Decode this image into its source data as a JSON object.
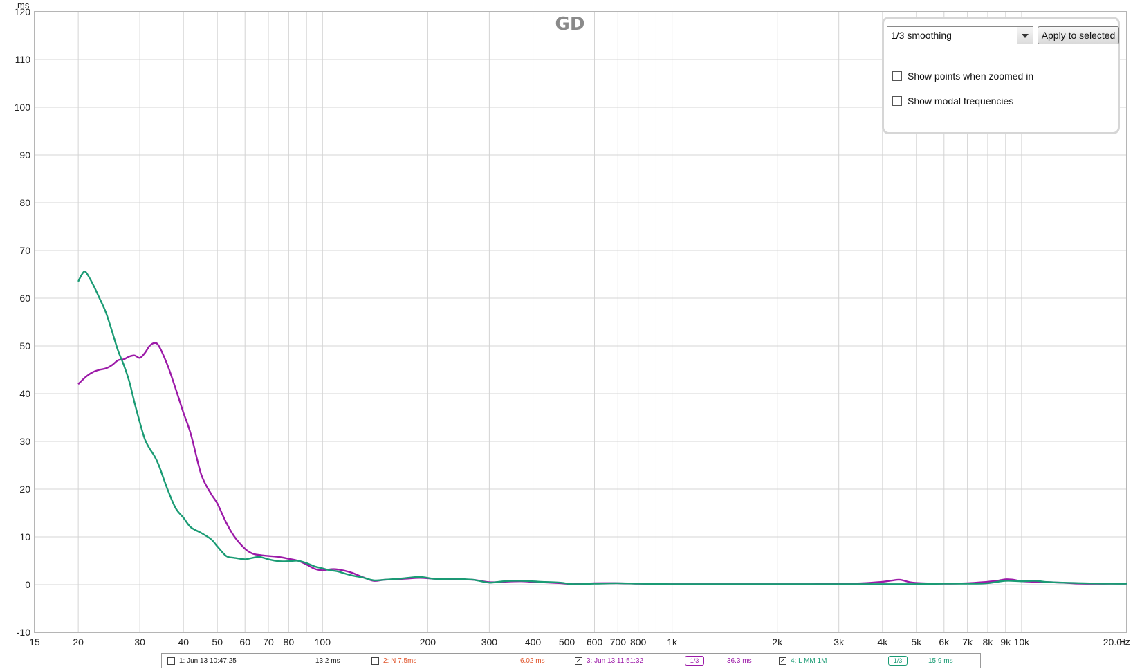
{
  "chart_data": {
    "type": "line",
    "title": "GD",
    "ylabel": "ms",
    "xunit": "Hz",
    "xscale": "log",
    "xlim": [
      15,
      20000
    ],
    "ylim": [
      -10,
      120
    ],
    "yticks": [
      -10,
      0,
      10,
      20,
      30,
      40,
      50,
      60,
      70,
      80,
      90,
      100,
      110,
      120
    ],
    "xticks": [
      {
        "v": 15,
        "label": "15"
      },
      {
        "v": 20,
        "label": "20"
      },
      {
        "v": 30,
        "label": "30"
      },
      {
        "v": 40,
        "label": "40"
      },
      {
        "v": 50,
        "label": "50"
      },
      {
        "v": 60,
        "label": "60"
      },
      {
        "v": 70,
        "label": "70"
      },
      {
        "v": 80,
        "label": "80"
      },
      {
        "v": 100,
        "label": "100"
      },
      {
        "v": 200,
        "label": "200"
      },
      {
        "v": 300,
        "label": "300"
      },
      {
        "v": 400,
        "label": "400"
      },
      {
        "v": 500,
        "label": "500"
      },
      {
        "v": 600,
        "label": "600"
      },
      {
        "v": 700,
        "label": "700"
      },
      {
        "v": 800,
        "label": "800"
      },
      {
        "v": 1000,
        "label": "1k"
      },
      {
        "v": 2000,
        "label": "2k"
      },
      {
        "v": 3000,
        "label": "3k"
      },
      {
        "v": 4000,
        "label": "4k"
      },
      {
        "v": 5000,
        "label": "5k"
      },
      {
        "v": 6000,
        "label": "6k"
      },
      {
        "v": 7000,
        "label": "7k"
      },
      {
        "v": 8000,
        "label": "8k"
      },
      {
        "v": 9000,
        "label": "9k"
      },
      {
        "v": 10000,
        "label": "10k"
      },
      {
        "v": 20000,
        "label": "20.0k"
      }
    ],
    "grid": true,
    "series": [
      {
        "name": "3: Jun 13 11:51:32",
        "color": "#9c1aa8",
        "x": [
          20,
          21,
          22,
          23,
          24,
          25,
          26,
          27,
          28,
          29,
          30,
          31,
          32,
          33,
          34,
          36,
          38,
          40,
          42,
          45,
          48,
          50,
          53,
          56,
          60,
          63,
          66,
          70,
          75,
          80,
          85,
          90,
          95,
          100,
          105,
          110,
          120,
          130,
          140,
          150,
          170,
          190,
          210,
          240,
          270,
          300,
          330,
          370,
          420,
          480,
          520,
          600,
          700,
          800,
          1000,
          1300,
          1600,
          2000,
          2500,
          3000,
          3500,
          4000,
          4300,
          4500,
          4800,
          5200,
          6000,
          7000,
          8000,
          8500,
          9000,
          9500,
          10000,
          11000,
          12000,
          13000,
          15000,
          18000,
          20000
        ],
        "y": [
          42,
          43.5,
          44.5,
          45,
          45.3,
          46,
          47,
          47.2,
          47.8,
          48,
          47.5,
          48.5,
          50,
          50.6,
          50,
          46,
          41,
          36,
          31.5,
          23,
          19,
          17,
          13,
          10,
          7.5,
          6.5,
          6.2,
          6,
          5.8,
          5.4,
          5,
          4.2,
          3.3,
          3,
          3.2,
          3.2,
          2.6,
          1.6,
          0.8,
          1,
          1.2,
          1.4,
          1.2,
          1.1,
          1,
          0.5,
          0.6,
          0.7,
          0.5,
          0.3,
          0.1,
          0.3,
          0.3,
          0.2,
          0.1,
          0.1,
          0.1,
          0.1,
          0.1,
          0.2,
          0.3,
          0.6,
          0.9,
          1,
          0.5,
          0.3,
          0.2,
          0.3,
          0.6,
          0.8,
          1.1,
          1,
          0.7,
          0.6,
          0.5,
          0.4,
          0.2,
          0.2,
          0.2
        ]
      },
      {
        "name": "4: L MM 1M",
        "color": "#1a9b74",
        "x": [
          20,
          20.5,
          21,
          22,
          23,
          24,
          25,
          26,
          27,
          28,
          29,
          30,
          31,
          32,
          33,
          34,
          36,
          38,
          40,
          42,
          45,
          48,
          50,
          53,
          56,
          60,
          63,
          66,
          70,
          75,
          80,
          85,
          90,
          95,
          100,
          105,
          110,
          120,
          130,
          140,
          150,
          170,
          190,
          210,
          240,
          270,
          300,
          330,
          370,
          420,
          480,
          520,
          600,
          700,
          800,
          1000,
          1300,
          1600,
          2000,
          2500,
          3000,
          3500,
          4000,
          4500,
          5000,
          6000,
          7000,
          8000,
          9000,
          10000,
          11000,
          12000,
          15000,
          18000,
          20000
        ],
        "y": [
          63.5,
          65,
          65.5,
          63,
          60,
          57,
          53,
          49,
          46,
          42.5,
          38,
          34,
          30.5,
          28.5,
          27,
          25,
          20,
          16,
          14,
          12,
          10.8,
          9.5,
          8,
          6,
          5.6,
          5.3,
          5.6,
          5.8,
          5.3,
          4.9,
          4.9,
          5,
          4.5,
          3.8,
          3.4,
          3,
          2.8,
          2,
          1.5,
          0.9,
          1,
          1.3,
          1.6,
          1.2,
          1.2,
          1,
          0.4,
          0.7,
          0.8,
          0.6,
          0.4,
          0.1,
          0.2,
          0.3,
          0.2,
          0.1,
          0.1,
          0.1,
          0.1,
          0.1,
          0.1,
          0.1,
          0.1,
          0.1,
          0.1,
          0.2,
          0.2,
          0.3,
          0.8,
          0.7,
          0.8,
          0.5,
          0.3,
          0.2,
          0.2
        ]
      }
    ]
  },
  "controls": {
    "smoothing_select": "1/3 smoothing",
    "apply_button": "Apply to selected",
    "show_points": {
      "label": "Show points when zoomed in",
      "checked": false
    },
    "show_modal": {
      "label": "Show modal frequencies",
      "checked": false
    }
  },
  "legend": [
    {
      "name": "1: Jun 13 10:47:25",
      "value": "13.2 ms",
      "checked": false,
      "color": "#222222",
      "smoothing": ""
    },
    {
      "name": "2: N 7.5ms",
      "value": "6.02 ms",
      "checked": false,
      "color": "#e0542a",
      "smoothing": ""
    },
    {
      "name": "3: Jun 13 11:51:32",
      "value": "36.3 ms",
      "checked": true,
      "color": "#9c1aa8",
      "smoothing": "1/3"
    },
    {
      "name": "4: L MM 1M",
      "value": "15.9 ms",
      "checked": true,
      "color": "#1a9b74",
      "smoothing": "1/3"
    }
  ]
}
